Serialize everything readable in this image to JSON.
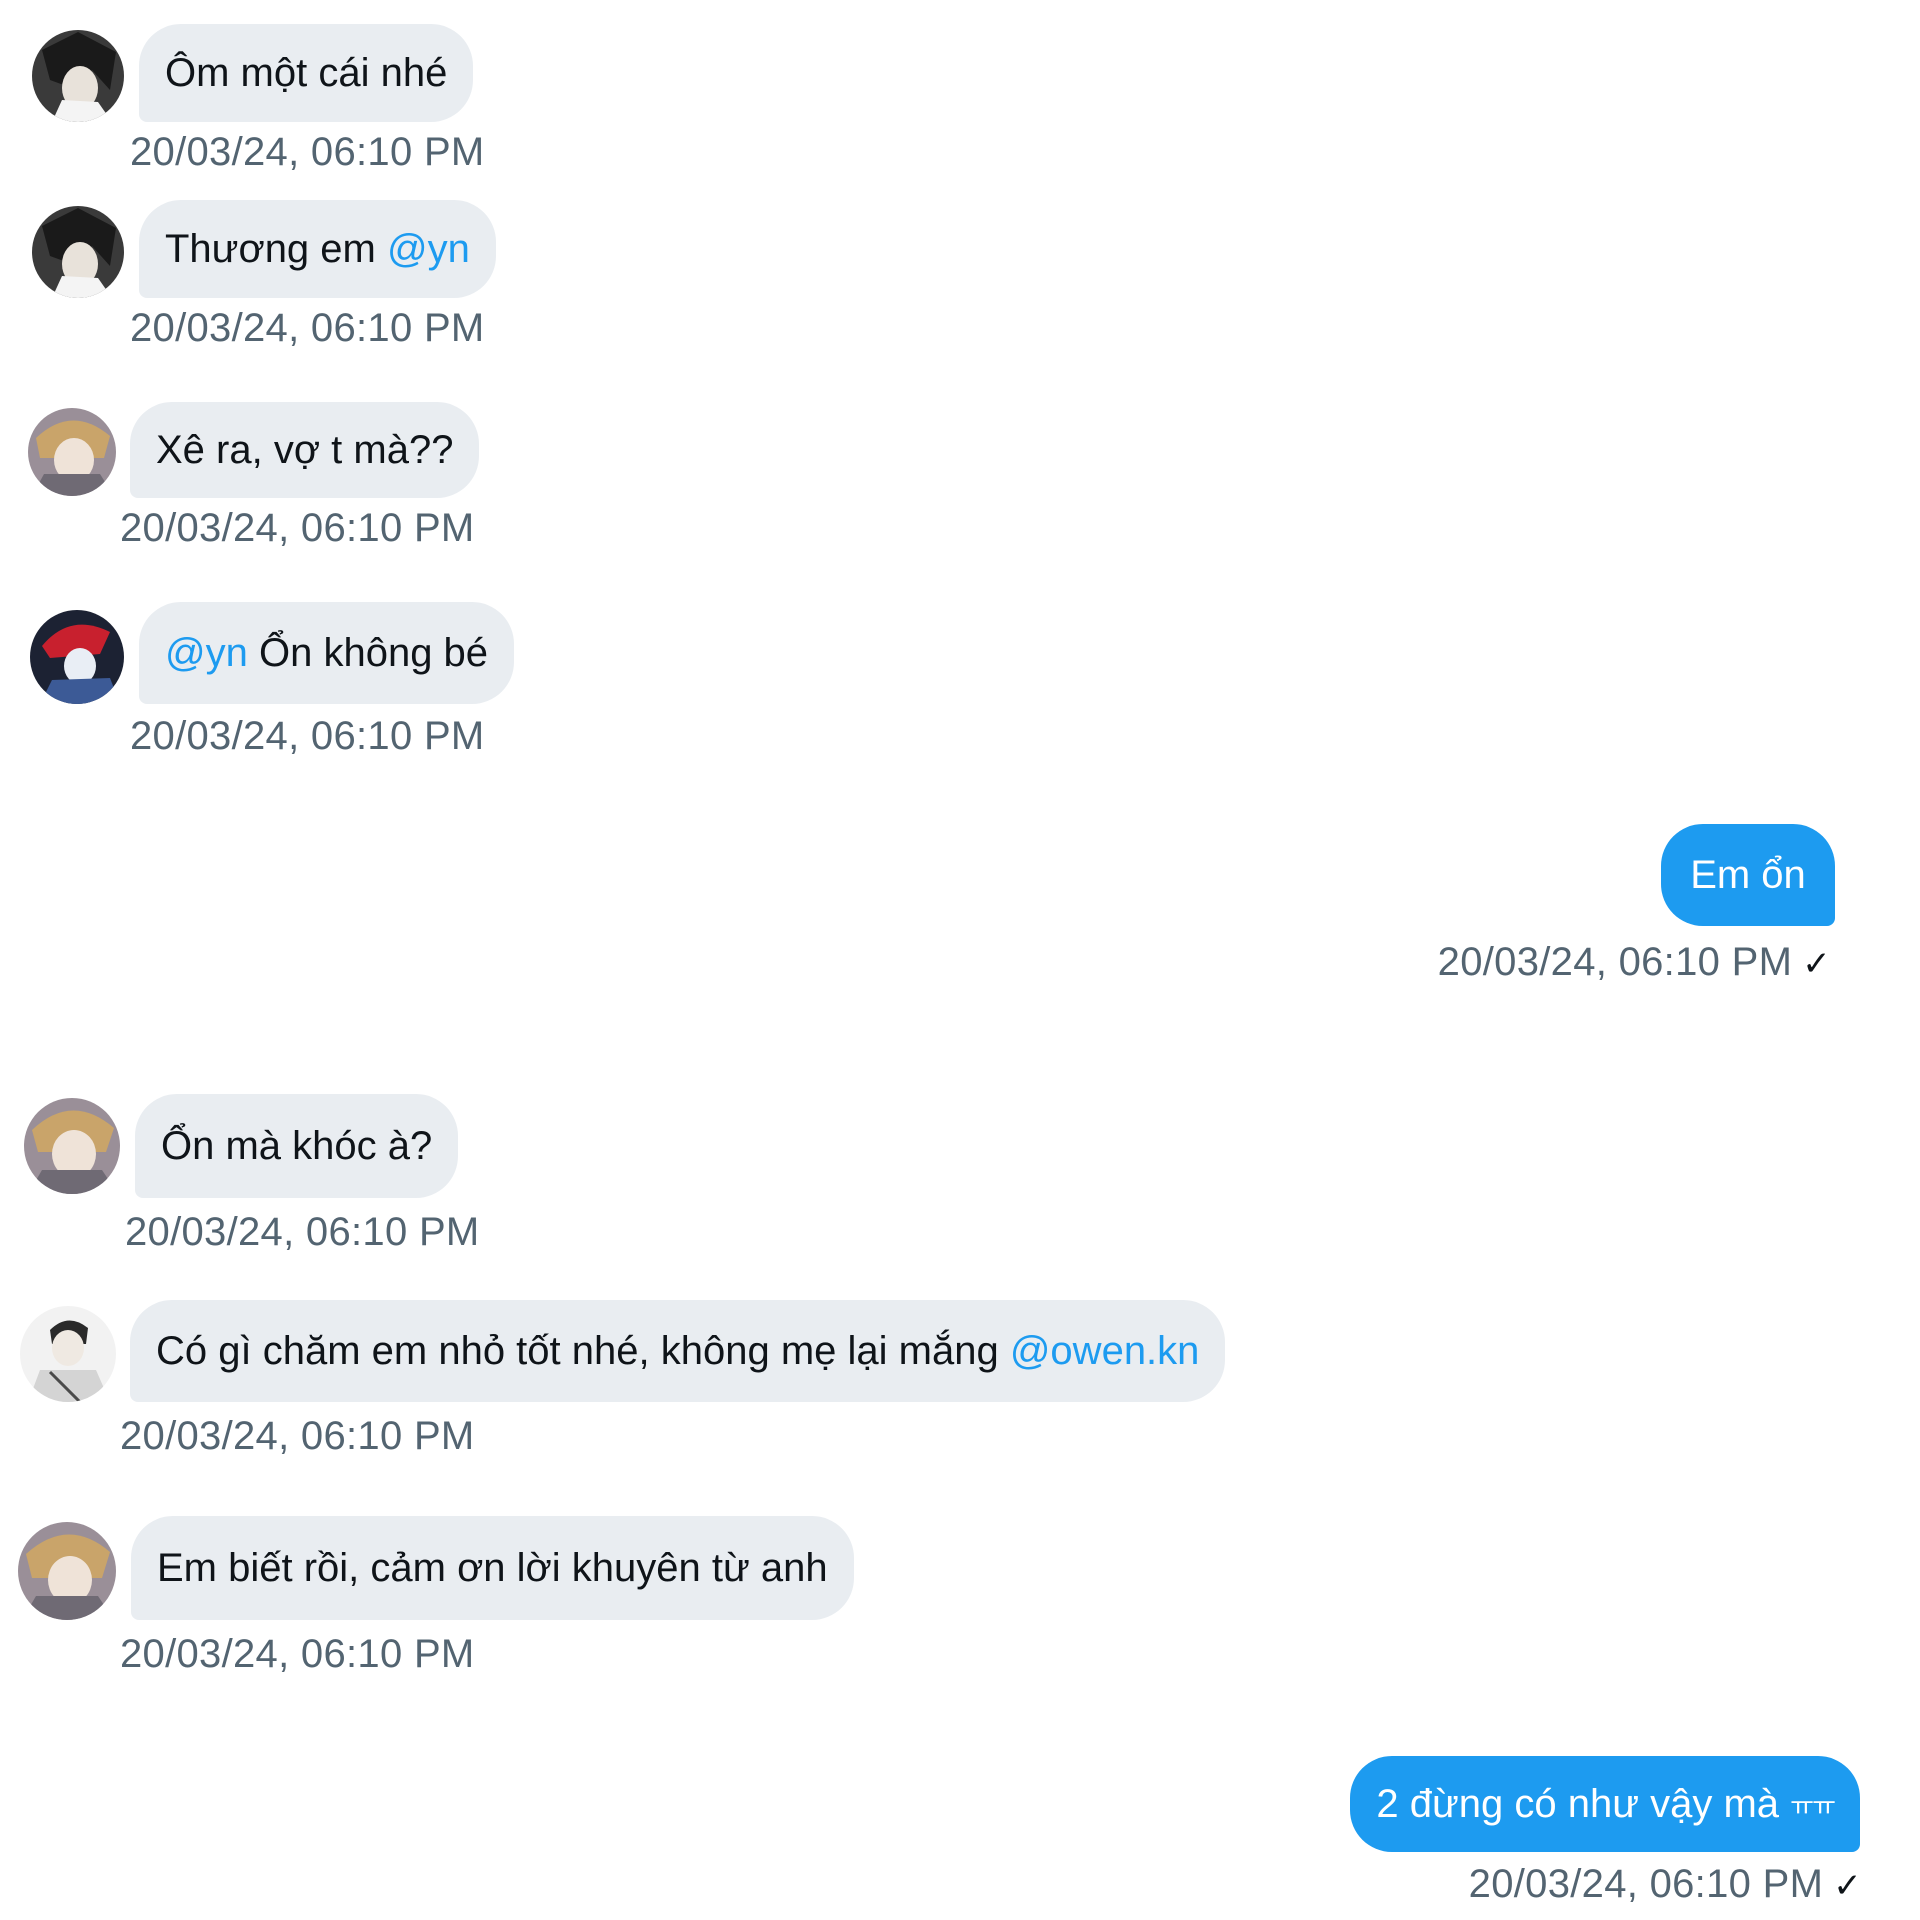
{
  "messages": [
    {
      "direction": "in",
      "avatar": "avatar-dark-hair",
      "pre_mention": "",
      "text": "Ôm một cái nhé",
      "mention": "",
      "timestamp": "20/03/24, 06:10 PM"
    },
    {
      "direction": "in",
      "avatar": "avatar-dark-hair",
      "pre_mention": "",
      "text": "Thương em",
      "mention": "@yn",
      "timestamp": "20/03/24, 06:10 PM"
    },
    {
      "direction": "in",
      "avatar": "avatar-blond-hair",
      "pre_mention": "",
      "text": "Xê ra, vợ t mà??",
      "mention": "",
      "timestamp": "20/03/24, 06:10 PM"
    },
    {
      "direction": "in",
      "avatar": "avatar-red-hair",
      "pre_mention": "@yn",
      "text": "Ổn không bé",
      "mention": "",
      "timestamp": "20/03/24, 06:10 PM"
    },
    {
      "direction": "out",
      "text": "Em ổn",
      "suffix": "",
      "timestamp": "20/03/24, 06:10 PM",
      "check": "✓"
    },
    {
      "direction": "in",
      "avatar": "avatar-blond-hair",
      "pre_mention": "",
      "text": "Ổn mà khóc à?",
      "mention": "",
      "timestamp": "20/03/24, 06:10 PM"
    },
    {
      "direction": "in",
      "avatar": "avatar-grey-coat",
      "pre_mention": "",
      "text": "Có gì chăm em nhỏ tốt nhé, không mẹ lại mắng",
      "mention": "@owen.kn",
      "timestamp": "20/03/24, 06:10 PM"
    },
    {
      "direction": "in",
      "avatar": "avatar-blond-hair",
      "pre_mention": "",
      "text": "Em biết rồi, cảm ơn lời khuyên từ anh",
      "mention": "",
      "timestamp": "20/03/24, 06:10 PM"
    },
    {
      "direction": "out",
      "text": "2 đừng có như vậy mà",
      "suffix": "ㅠㅠ",
      "timestamp": "20/03/24, 06:10 PM",
      "check": "✓"
    }
  ],
  "colors": {
    "outgoing_bubble": "#1d9bf0",
    "incoming_bubble": "#e9edf1",
    "mention": "#1d9bf0",
    "timestamp": "#536471"
  }
}
